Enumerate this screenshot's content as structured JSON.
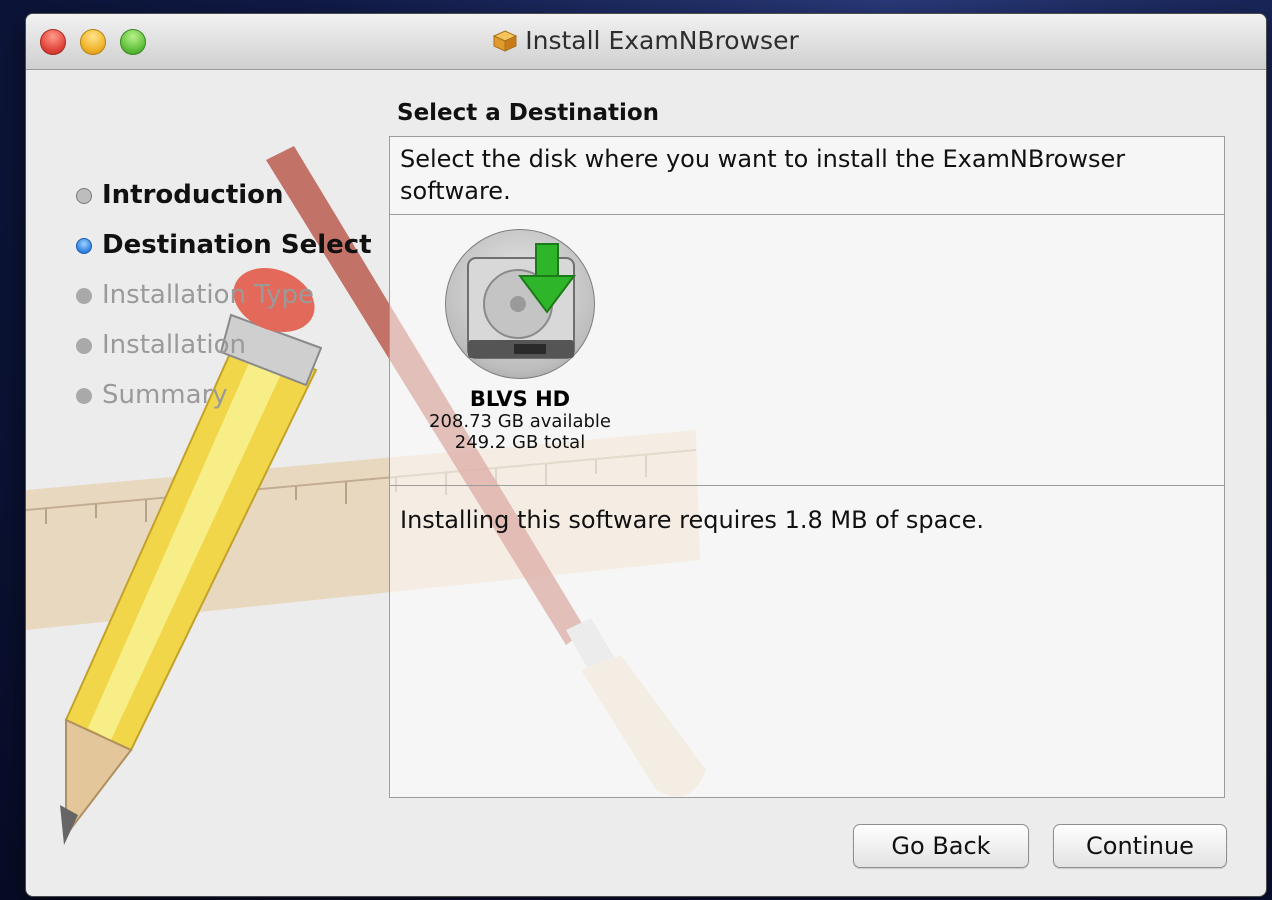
{
  "window": {
    "title": "Install ExamNBrowser",
    "title_icon": "package-icon"
  },
  "sidebar": {
    "steps": [
      {
        "label": "Introduction",
        "state": "done"
      },
      {
        "label": "Destination Select",
        "state": "current"
      },
      {
        "label": "Installation Type",
        "state": "pending"
      },
      {
        "label": "Installation",
        "state": "pending"
      },
      {
        "label": "Summary",
        "state": "pending"
      }
    ]
  },
  "main": {
    "heading": "Select a Destination",
    "description": "Select the disk where you want to install the ExamNBrowser software.",
    "disk": {
      "name": "BLVS HD",
      "available": "208.73 GB available",
      "total": "249.2 GB total",
      "icon": "hard-drive-install-icon"
    },
    "space_required": "Installing this software requires 1.8 MB of space."
  },
  "footer": {
    "back_label": "Go Back",
    "continue_label": "Continue"
  },
  "colors": {
    "selected_step": "#2d7fe0",
    "install_arrow": "#2fb52a"
  }
}
